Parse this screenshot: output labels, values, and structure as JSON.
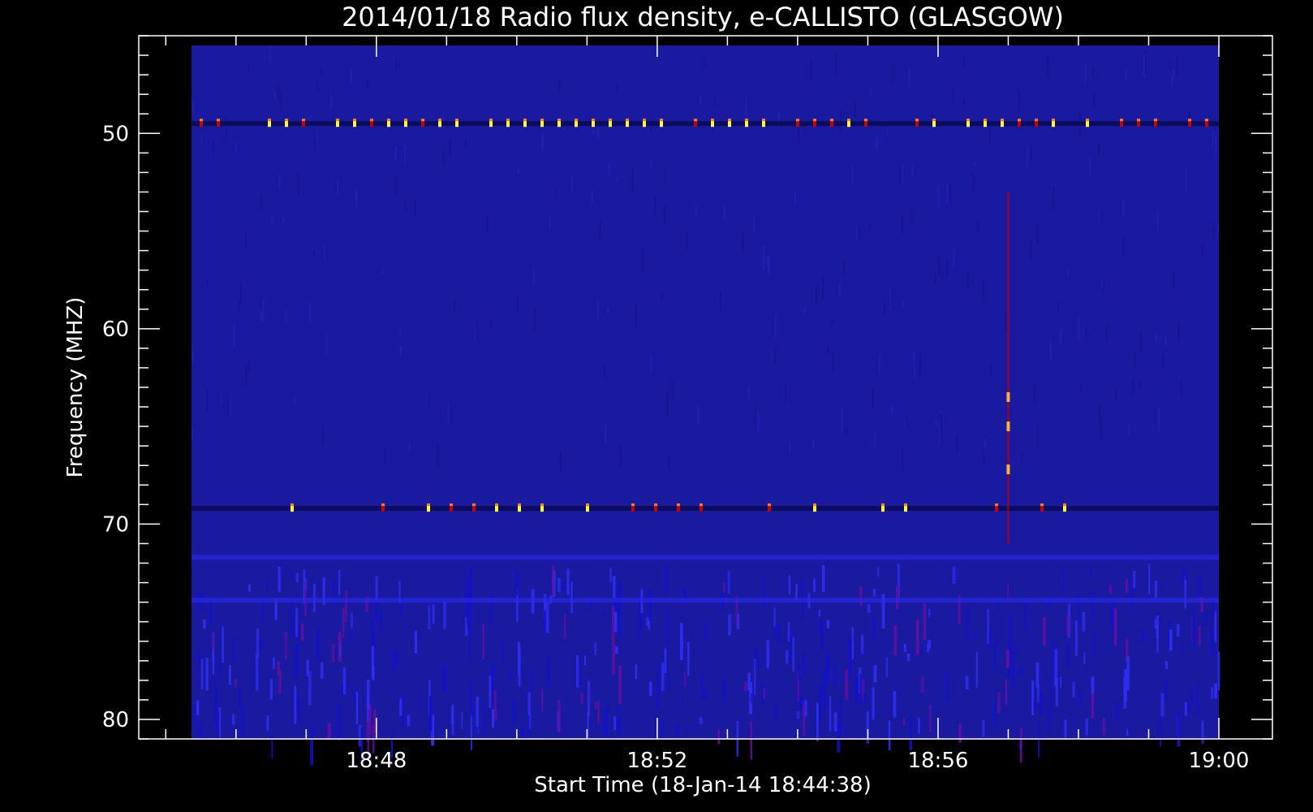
{
  "chart_data": {
    "type": "heatmap",
    "title": "2014/01/18  Radio flux density, e-CALLISTO (GLASGOW)",
    "xlabel": "Start Time (18-Jan-14 18:44:38)",
    "ylabel": "Frequency (MHZ)",
    "x_axis": {
      "unit": "time",
      "range": [
        "18:44:38",
        "19:00:00"
      ],
      "ticks": [
        {
          "value": "18:48",
          "label": "18:48"
        },
        {
          "value": "18:52",
          "label": "18:52"
        },
        {
          "value": "18:56",
          "label": "18:56"
        },
        {
          "value": "19:00",
          "label": "19:00"
        }
      ]
    },
    "y_axis": {
      "unit": "MHz",
      "inverted": true,
      "range": [
        45.0,
        81.0
      ],
      "ticks": [
        {
          "value": 50,
          "label": "50"
        },
        {
          "value": 60,
          "label": "60"
        },
        {
          "value": 70,
          "label": "70"
        },
        {
          "value": 80,
          "label": "80"
        }
      ]
    },
    "data_extent": {
      "time": [
        "18:45:22",
        "19:00:00"
      ],
      "freq_mhz": [
        45.5,
        81.0
      ]
    },
    "colormap": {
      "background": "#1a1aa0",
      "low": "#000060",
      "mid": "#c00000",
      "high": "#ffff40"
    },
    "features": [
      {
        "kind": "interference-line",
        "freq_mhz": 49.5,
        "intensity": "high"
      },
      {
        "kind": "interference-line",
        "freq_mhz": 69.2,
        "intensity": "medium"
      },
      {
        "kind": "interference-line",
        "freq_mhz": 71.7,
        "intensity": "low"
      },
      {
        "kind": "interference-line",
        "freq_mhz": 73.9,
        "intensity": "low"
      },
      {
        "kind": "vertical-spike",
        "time": "18:57:00",
        "freq_range_mhz": [
          53,
          71
        ],
        "intensity": "medium"
      }
    ],
    "grid": false,
    "legend": "none"
  }
}
